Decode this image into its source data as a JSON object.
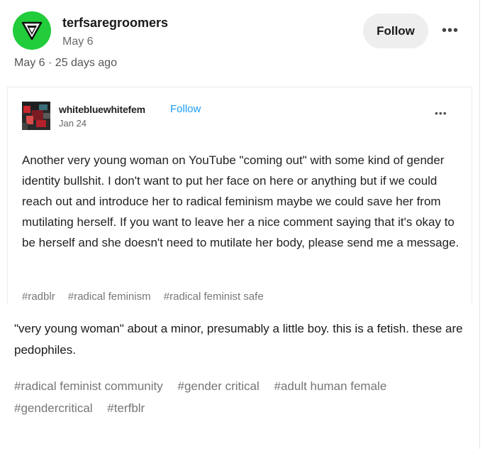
{
  "header": {
    "username": "terfsaregroomers",
    "date": "May 6",
    "follow_label": "Follow",
    "more_label": "•••",
    "meta": "May 6 · 25 days ago"
  },
  "embedded": {
    "username": "whitebluewhitefem",
    "follow_label": "Follow",
    "date": "Jan 24",
    "more_label": "•••",
    "body": "Another very young woman on YouTube \"coming out\" with some kind of gender identity bullshit. I don't want to put her face on here or anything but if we could reach out and introduce her to radical feminism maybe we could save her from mutilating herself. If you want to leave her a nice comment saying that it's okay to be herself and she doesn't need to mutilate her body, please send me a message.",
    "tags": [
      "#radblr",
      "#radical feminism",
      "#radical feminist safe"
    ]
  },
  "caption": "\"very young woman\" about a minor, presumably a little boy. this is a fetish. these are pedophiles.",
  "tags": [
    "#radical feminist community",
    "#gender critical",
    "#adult human female",
    "#gendercritical",
    "#terfblr"
  ],
  "colors": {
    "avatar_bg": "#22cc3a",
    "follow_link": "#1d9bf0",
    "tag_text": "#757575"
  }
}
